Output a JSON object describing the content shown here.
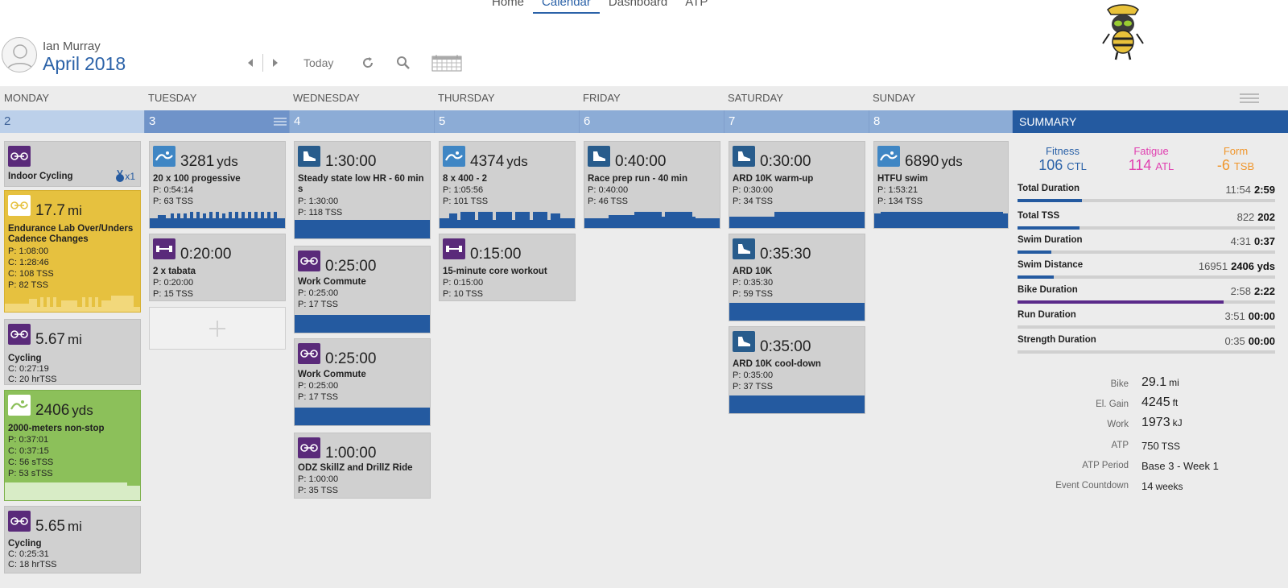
{
  "nav": {
    "items": [
      "Home",
      "Calendar",
      "Dashboard",
      "ATP"
    ],
    "active": "Calendar"
  },
  "header": {
    "user": "Ian Murray",
    "month": "April",
    "year": "2018"
  },
  "toolbar": {
    "today": "Today"
  },
  "days": [
    "MONDAY",
    "TUESDAY",
    "WEDNESDAY",
    "THURSDAY",
    "FRIDAY",
    "SATURDAY",
    "SUNDAY"
  ],
  "dates": [
    "2",
    "3",
    "4",
    "5",
    "6",
    "7",
    "8"
  ],
  "summary_title": "SUMMARY",
  "cards": {
    "mon1": {
      "title": "Indoor Cycling",
      "badge": "x1"
    },
    "mon2": {
      "value": "17.7",
      "unit": "mi",
      "title": "Endurance Lab Over/Unders Cadence Changes",
      "lines": [
        "P: 1:08:00",
        "C: 1:28:46",
        "C: 108 TSS",
        "P: 82 TSS"
      ]
    },
    "mon3": {
      "value": "5.67",
      "unit": "mi",
      "title": "Cycling",
      "lines": [
        "C: 0:27:19",
        "C: 20 hrTSS"
      ]
    },
    "mon4": {
      "value": "2406",
      "unit": "yds",
      "title": "2000-meters non-stop",
      "lines": [
        "P: 0:37:01",
        "C: 0:37:15",
        "C: 56 sTSS",
        "P: 53 sTSS"
      ]
    },
    "mon5": {
      "value": "5.65",
      "unit": "mi",
      "title": "Cycling",
      "lines": [
        "C: 0:25:31",
        "C: 18 hrTSS"
      ]
    },
    "tue1": {
      "value": "3281",
      "unit": "yds",
      "title": "20 x 100 progessive",
      "lines": [
        "P: 0:54:14",
        "P: 63 TSS"
      ]
    },
    "tue2": {
      "value": "0:20:00",
      "title": "2 x tabata",
      "lines": [
        "P: 0:20:00",
        "P: 15 TSS"
      ]
    },
    "wed1": {
      "value": "1:30:00",
      "title": "Steady state low HR - 60 min s",
      "lines": [
        "P: 1:30:00",
        "P: 118 TSS"
      ]
    },
    "wed2": {
      "value": "0:25:00",
      "title": "Work Commute",
      "lines": [
        "P: 0:25:00",
        "P: 17 TSS"
      ]
    },
    "wed3": {
      "value": "0:25:00",
      "title": "Work Commute",
      "lines": [
        "P: 0:25:00",
        "P: 17 TSS"
      ]
    },
    "wed4": {
      "value": "1:00:00",
      "title": "ODZ SkillZ and DrillZ Ride",
      "lines": [
        "P: 1:00:00",
        "P: 35 TSS"
      ]
    },
    "thu1": {
      "value": "4374",
      "unit": "yds",
      "title": "8 x 400 - 2",
      "lines": [
        "P: 1:05:56",
        "P: 101 TSS"
      ]
    },
    "thu2": {
      "value": "0:15:00",
      "title": "15-minute core workout",
      "lines": [
        "P: 0:15:00",
        "P: 10 TSS"
      ]
    },
    "fri1": {
      "value": "0:40:00",
      "title": "Race prep run - 40 min",
      "lines": [
        "P: 0:40:00",
        "P: 46 TSS"
      ]
    },
    "sat1": {
      "value": "0:30:00",
      "title": "ARD 10K warm-up",
      "lines": [
        "P: 0:30:00",
        "P: 34 TSS"
      ]
    },
    "sat2": {
      "value": "0:35:30",
      "title": "ARD 10K",
      "lines": [
        "P: 0:35:30",
        "P: 59 TSS"
      ]
    },
    "sat3": {
      "value": "0:35:00",
      "title": "ARD 10K cool-down",
      "lines": [
        "P: 0:35:00",
        "P: 37 TSS"
      ]
    },
    "sun1": {
      "value": "6890",
      "unit": "yds",
      "title": "HTFU swim",
      "lines": [
        "P: 1:53:21",
        "P: 134 TSS"
      ]
    }
  },
  "summary": {
    "fitness": {
      "label": "Fitness",
      "value": "106",
      "unit": "CTL",
      "color": "#2b62a8"
    },
    "fatigue": {
      "label": "Fatigue",
      "value": "114",
      "unit": "ATL",
      "color": "#e040b0"
    },
    "form": {
      "label": "Form",
      "value": "-6",
      "unit": "TSB",
      "color": "#f0962c"
    },
    "rows": [
      {
        "label": "Total Duration",
        "planned": "11:54",
        "completed": "2:59",
        "fill": 0.25
      },
      {
        "label": "Total TSS",
        "planned": "822",
        "completed": "202",
        "fill": 0.24
      },
      {
        "label": "Swim Duration",
        "planned": "4:31",
        "completed": "0:37",
        "fill": 0.13
      },
      {
        "label": "Swim Distance",
        "planned": "16951",
        "completed": "2406 yds",
        "fill": 0.14
      },
      {
        "label": "Bike Duration",
        "planned": "2:58",
        "completed": "2:22",
        "fill": 0.8
      },
      {
        "label": "Run Duration",
        "planned": "3:51",
        "completed": "00:00",
        "fill": 0
      },
      {
        "label": "Strength Duration",
        "planned": "0:35",
        "completed": "00:00",
        "fill": 0
      }
    ],
    "stats": [
      {
        "label": "Bike",
        "value": "29.1",
        "unit": "mi"
      },
      {
        "label": "El. Gain",
        "value": "4245",
        "unit": "ft"
      },
      {
        "label": "Work",
        "value": "1973",
        "unit": "kJ"
      },
      {
        "label": "ATP",
        "value": "750",
        "unit": "TSS"
      },
      {
        "label": "ATP Period",
        "value": "Base 3 - Week 1",
        "unit": ""
      },
      {
        "label": "Event Countdown",
        "value": "14",
        "unit": "weeks"
      }
    ]
  }
}
